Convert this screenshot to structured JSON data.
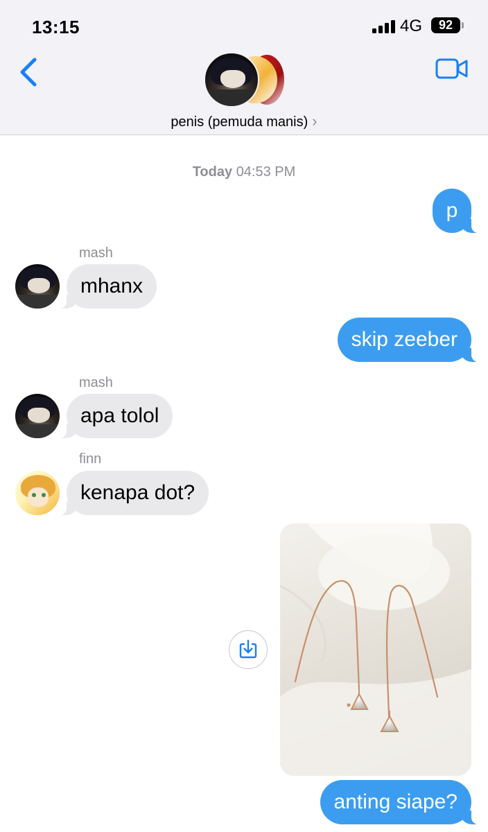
{
  "status_bar": {
    "time": "13:15",
    "network": "4G",
    "battery": "92"
  },
  "header": {
    "title": "penis (pemuda manis)",
    "chevron": "›"
  },
  "colors": {
    "outgoing_bubble": "#3c9df0",
    "incoming_bubble": "#e9e9eb",
    "ios_blue": "#1a7ff5"
  },
  "chat": {
    "timestamp": {
      "day": "Today",
      "time": "04:53 PM"
    },
    "messages": [
      {
        "direction": "out",
        "text": "p"
      },
      {
        "direction": "in",
        "sender": "mash",
        "text": "mhanx"
      },
      {
        "direction": "out",
        "text": "skip zeeber"
      },
      {
        "direction": "in",
        "sender": "mash",
        "text": "apa tolol"
      },
      {
        "direction": "in",
        "sender": "finn",
        "text": "kenapa dot?"
      },
      {
        "direction": "out",
        "type": "image",
        "image": "earrings-photo"
      },
      {
        "direction": "out",
        "text": "anting siape?"
      }
    ]
  },
  "icons": {
    "back": "chevron-left-icon",
    "video": "video-camera-icon",
    "download": "save-to-photos-icon"
  }
}
